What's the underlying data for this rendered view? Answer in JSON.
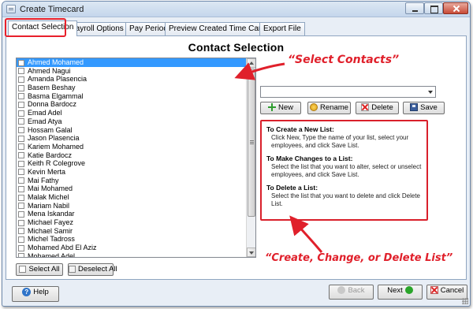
{
  "window": {
    "title": "Create Timecard"
  },
  "tabs": [
    {
      "label": "Contact Selection",
      "active": true
    },
    {
      "label": "Payroll Options",
      "active": false
    },
    {
      "label": "Pay Period",
      "active": false
    },
    {
      "label": "Preview Created Time Card",
      "active": false
    },
    {
      "label": "Export File",
      "active": false
    }
  ],
  "page": {
    "heading": "Contact Selection"
  },
  "contacts": [
    {
      "name": "Ahmed Mohamed",
      "selected": true
    },
    {
      "name": "Ahmed Nagui"
    },
    {
      "name": "Amanda Plasencia"
    },
    {
      "name": "Basem Beshay"
    },
    {
      "name": "Basma Elgammal"
    },
    {
      "name": "Donna Bardocz"
    },
    {
      "name": "Emad Adel"
    },
    {
      "name": "Emad Atya"
    },
    {
      "name": "Hossam Galal"
    },
    {
      "name": "Jason Plasencia"
    },
    {
      "name": "Kariem Mohamed"
    },
    {
      "name": "Katie Bardocz"
    },
    {
      "name": "Keith R Colegrove"
    },
    {
      "name": "Kevin Merta"
    },
    {
      "name": "Mai Fathy"
    },
    {
      "name": "Mai Mohamed"
    },
    {
      "name": "Malak Michel"
    },
    {
      "name": "Mariam Nabil"
    },
    {
      "name": "Mena Iskandar"
    },
    {
      "name": "Michael Fayez"
    },
    {
      "name": "Michael Samir"
    },
    {
      "name": "Michel Tadross"
    },
    {
      "name": "Mohamed Abd El Aziz"
    },
    {
      "name": "Mohamed Adel"
    }
  ],
  "selection": {
    "select_all": "Select All",
    "deselect_all": "Deselect All"
  },
  "list_actions": {
    "combo_value": "",
    "new": "New",
    "rename": "Rename",
    "delete": "Delete",
    "save": "Save"
  },
  "instructions": {
    "create_title": "To Create a New List:",
    "create_text": "Click New, Type the name of your list, select your employees, and click Save List.",
    "change_title": "To Make Changes to a List:",
    "change_text": "Select the list that you want to alter, select or unselect employees, and click Save List.",
    "delete_title": "To Delete a List:",
    "delete_text": "Select the list that you want to delete and click Delete List."
  },
  "annotations": {
    "select_contacts": "“Select Contacts”",
    "create_change_delete": "“Create, Change, or Delete List”",
    "color": "#e0202b"
  },
  "footer": {
    "help": "Help",
    "back": "Back",
    "next": "Next",
    "cancel": "Cancel"
  },
  "colors": {
    "selection": "#3399ff",
    "highlight": "#d9202b"
  }
}
